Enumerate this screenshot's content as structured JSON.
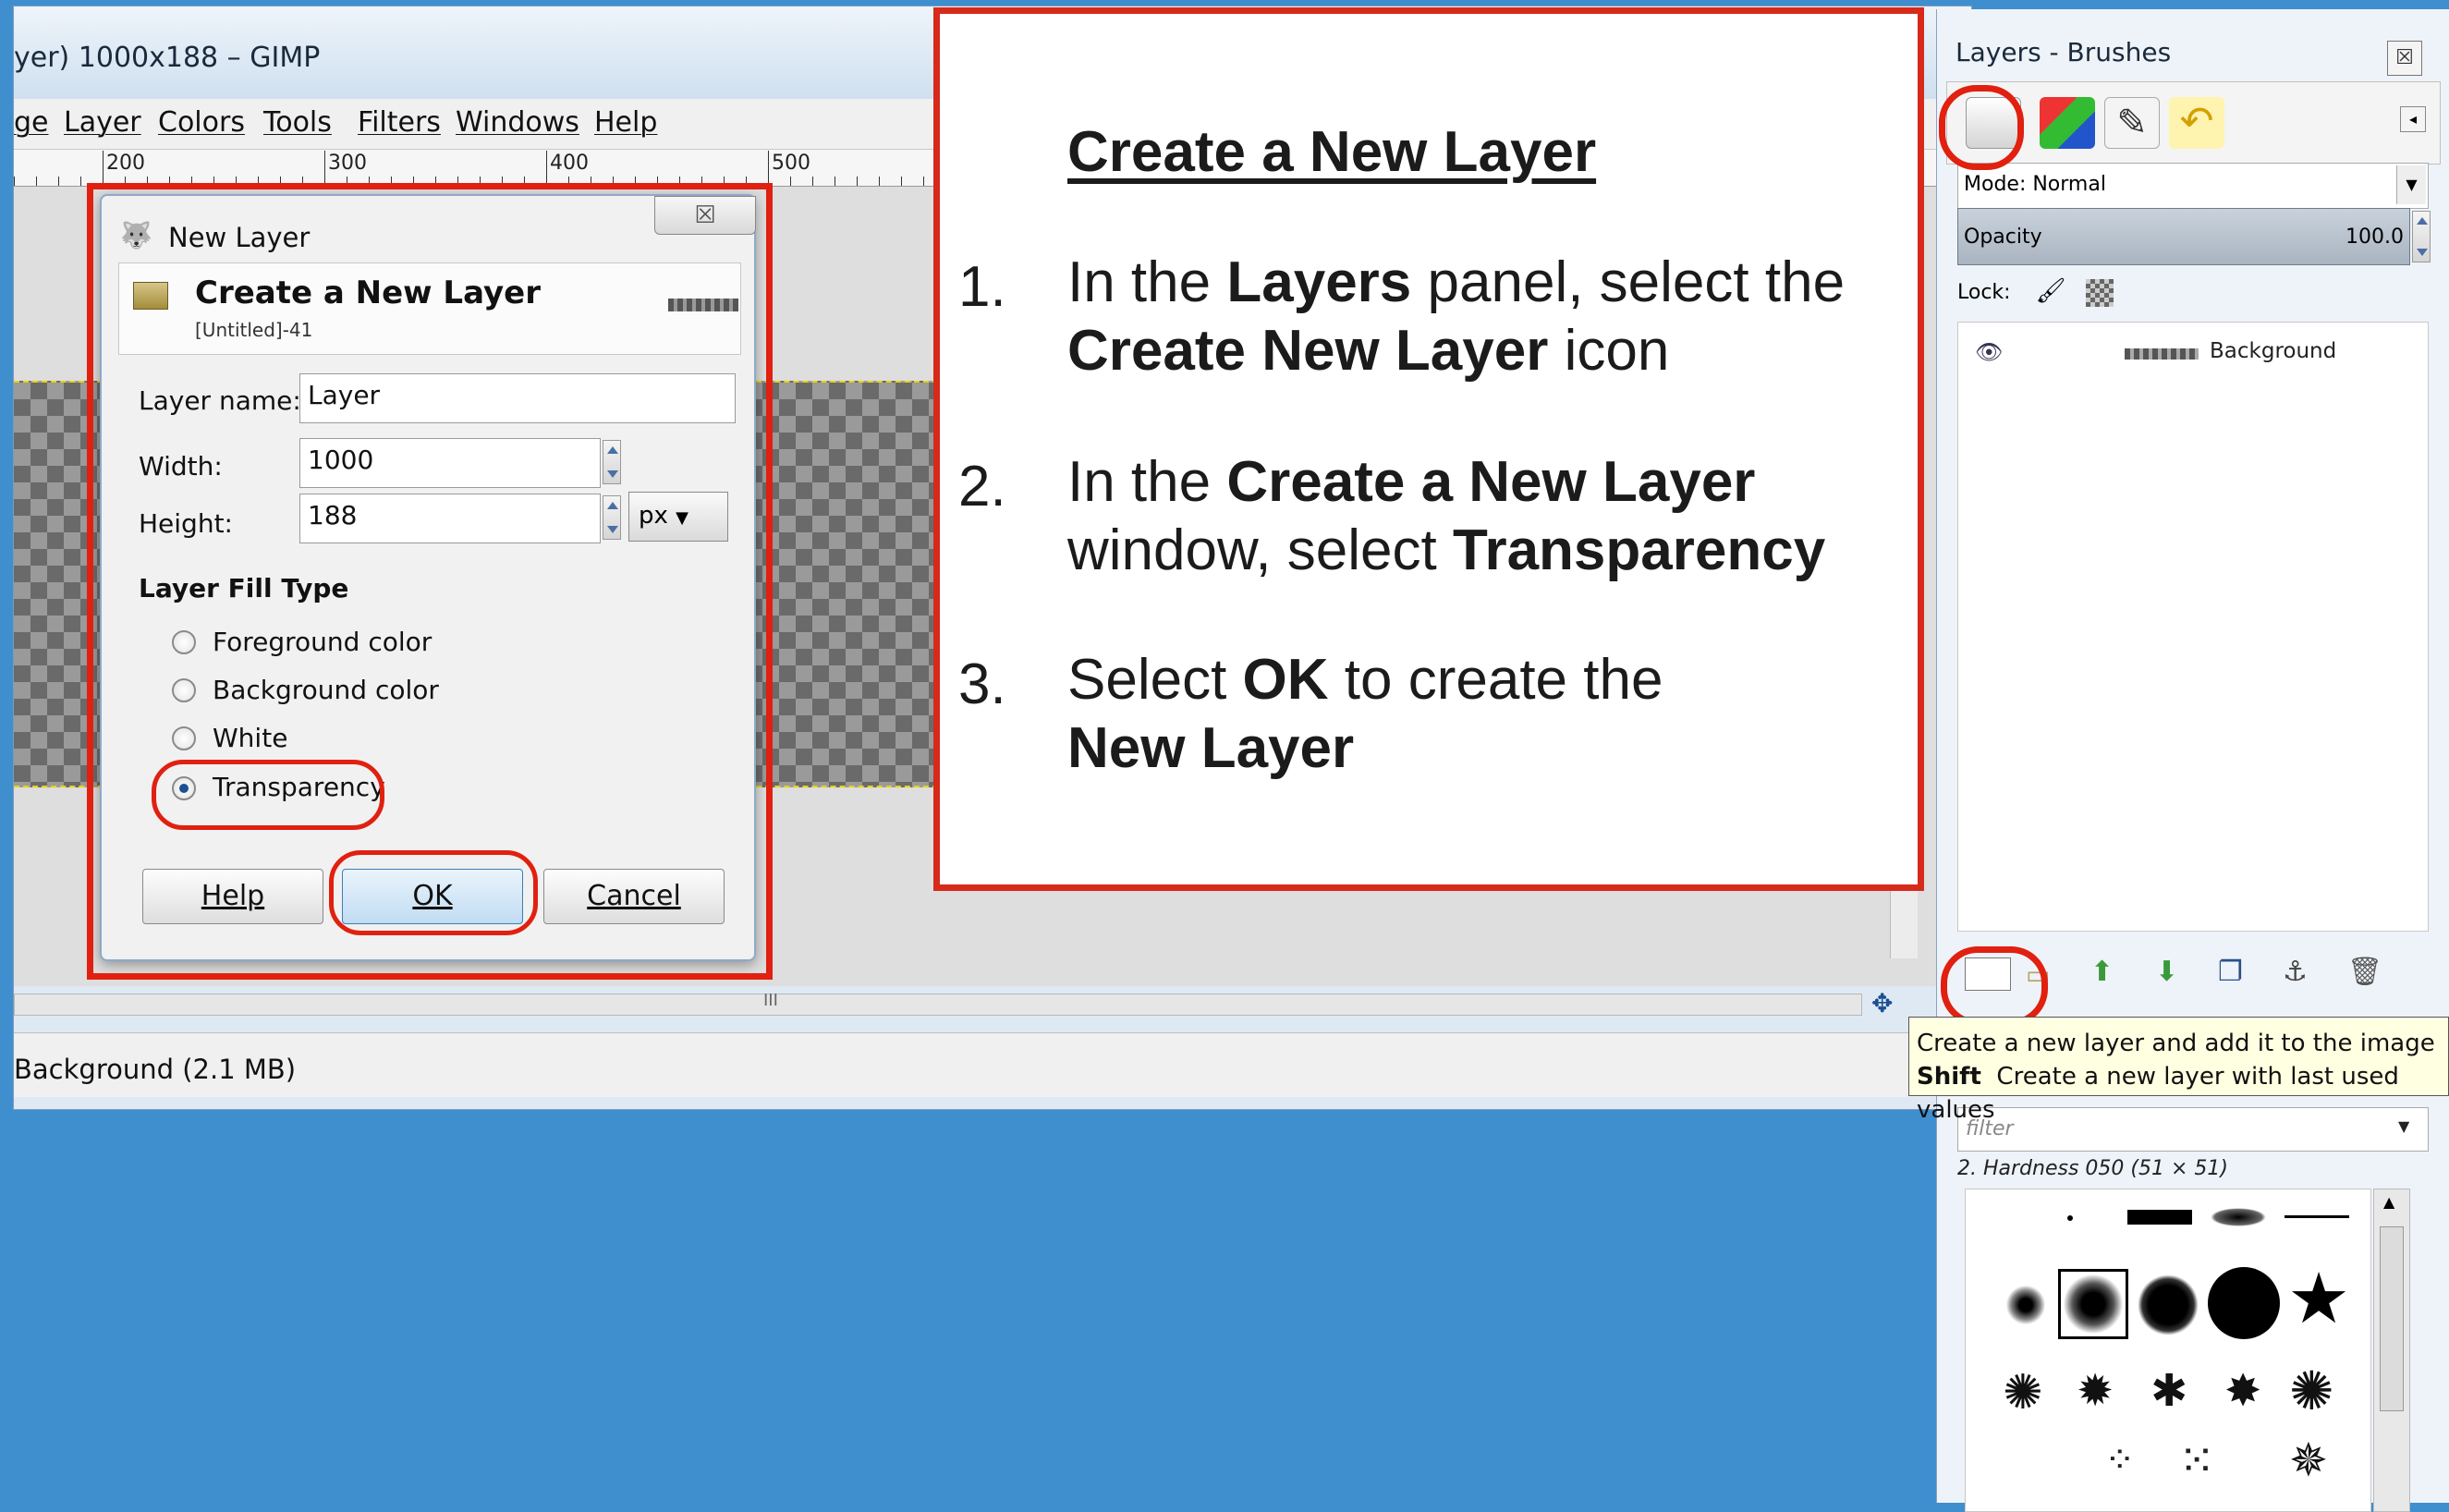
{
  "gimp": {
    "title": "yer) 1000x188 – GIMP",
    "menu": [
      "ge",
      "Layer",
      "Colors",
      "Tools",
      "Filters",
      "Windows",
      "Help"
    ],
    "ruler_labels": [
      "200",
      "300",
      "400",
      "500"
    ],
    "status": "Background (2.1 MB)",
    "scroll_grip": "III"
  },
  "dialog": {
    "window_title": "New Layer",
    "close_label": "☒",
    "header_title": "Create a New Layer",
    "header_subtitle": "[Untitled]-41",
    "layer_name_label": "Layer name:",
    "layer_name_value": "Layer",
    "width_label": "Width:",
    "width_value": "1000",
    "height_label": "Height:",
    "height_value": "188",
    "unit": "px",
    "fill_type_label": "Layer Fill Type",
    "fill_options": [
      "Foreground color",
      "Background color",
      "White",
      "Transparency"
    ],
    "fill_selected": "Transparency",
    "buttons": {
      "help": "Help",
      "ok": "OK",
      "cancel": "Cancel"
    }
  },
  "instructions": {
    "title": "Create a New Layer",
    "steps": [
      {
        "num": "1.",
        "parts": [
          "In the ",
          "Layers",
          " panel, select the ",
          "Create New Layer",
          " icon"
        ]
      },
      {
        "num": "2.",
        "parts": [
          "In the ",
          "Create a New Layer",
          " window, select ",
          "Transparency"
        ]
      },
      {
        "num": "3.",
        "parts": [
          "Select ",
          "OK",
          " to create the ",
          "New Layer"
        ]
      }
    ]
  },
  "dock": {
    "title": "Layers - Brushes",
    "close_label": "☒",
    "mode_label": "Mode: Normal",
    "opacity_label": "Opacity",
    "opacity_value": "100.0",
    "lock_label": "Lock:",
    "layer_name": "Background",
    "tooltip_line1": "Create a new layer and add it to the image",
    "tooltip_line2_key": "Shift",
    "tooltip_line2_text": "Create a new layer with last used values",
    "brush_filter_placeholder": "filter",
    "brush_name": "2. Hardness 050 (51 × 51)"
  },
  "colors": {
    "highlight_red": "#e12010",
    "desktop_blue": "#3f8fce"
  }
}
